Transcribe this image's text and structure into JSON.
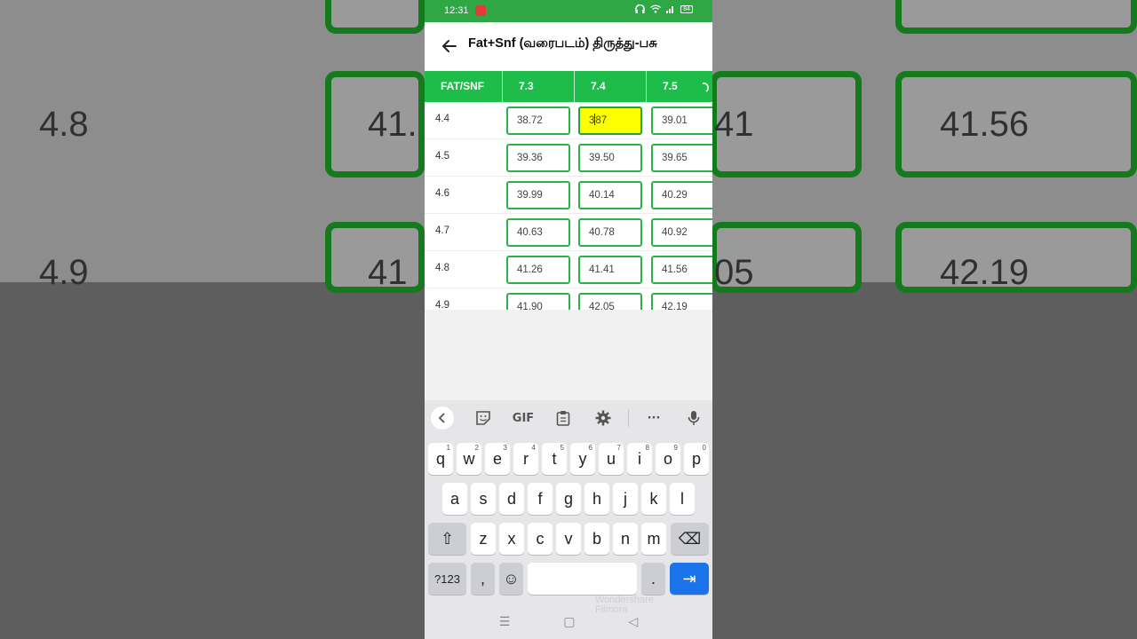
{
  "background_zoom": {
    "label_top": "4.8",
    "label_bottom": "4.9",
    "box_values": [
      "41.",
      "41",
      "41.56",
      "41",
      "05",
      "42.19"
    ]
  },
  "status_bar": {
    "time": "12:31",
    "battery": "84"
  },
  "app_bar": {
    "title": "Fat+Snf (வரைபடம்) திருத்து-பசு"
  },
  "table": {
    "corner_header": "FAT/SNF",
    "columns": [
      "7.3",
      "7.4",
      "7.5"
    ],
    "rows": [
      {
        "label": "4.4",
        "values": [
          "38.72",
          "3",
          "39.01"
        ],
        "active_suffix": "87"
      },
      {
        "label": "4.5",
        "values": [
          "39.36",
          "39.50",
          "39.65"
        ]
      },
      {
        "label": "4.6",
        "values": [
          "39.99",
          "40.14",
          "40.29"
        ]
      },
      {
        "label": "4.7",
        "values": [
          "40.63",
          "40.78",
          "40.92"
        ]
      },
      {
        "label": "4.8",
        "values": [
          "41.26",
          "41.41",
          "41.56"
        ]
      },
      {
        "label": "4.9",
        "values": [
          "41.90",
          "42.05",
          "42.19"
        ]
      }
    ]
  },
  "keyboard": {
    "gif_label": "GIF",
    "more_label": "···",
    "row1": [
      {
        "k": "q",
        "n": "1"
      },
      {
        "k": "w",
        "n": "2"
      },
      {
        "k": "e",
        "n": "3"
      },
      {
        "k": "r",
        "n": "4"
      },
      {
        "k": "t",
        "n": "5"
      },
      {
        "k": "y",
        "n": "6"
      },
      {
        "k": "u",
        "n": "7"
      },
      {
        "k": "i",
        "n": "8"
      },
      {
        "k": "o",
        "n": "9"
      },
      {
        "k": "p",
        "n": "0"
      }
    ],
    "row2": [
      "a",
      "s",
      "d",
      "f",
      "g",
      "h",
      "j",
      "k",
      "l"
    ],
    "row3": [
      "z",
      "x",
      "c",
      "v",
      "b",
      "n",
      "m"
    ],
    "symbols_label": "?123",
    "comma_label": ",",
    "period_label": ".",
    "shift_icon": "⇧",
    "backspace_icon": "⌫",
    "emoji_icon": "☺",
    "next_icon": "⇥"
  },
  "watermark": {
    "line1": "Wondershare",
    "line2": "Filmora"
  },
  "nav": {
    "recents": "☰",
    "home": "▢",
    "back": "◁"
  }
}
